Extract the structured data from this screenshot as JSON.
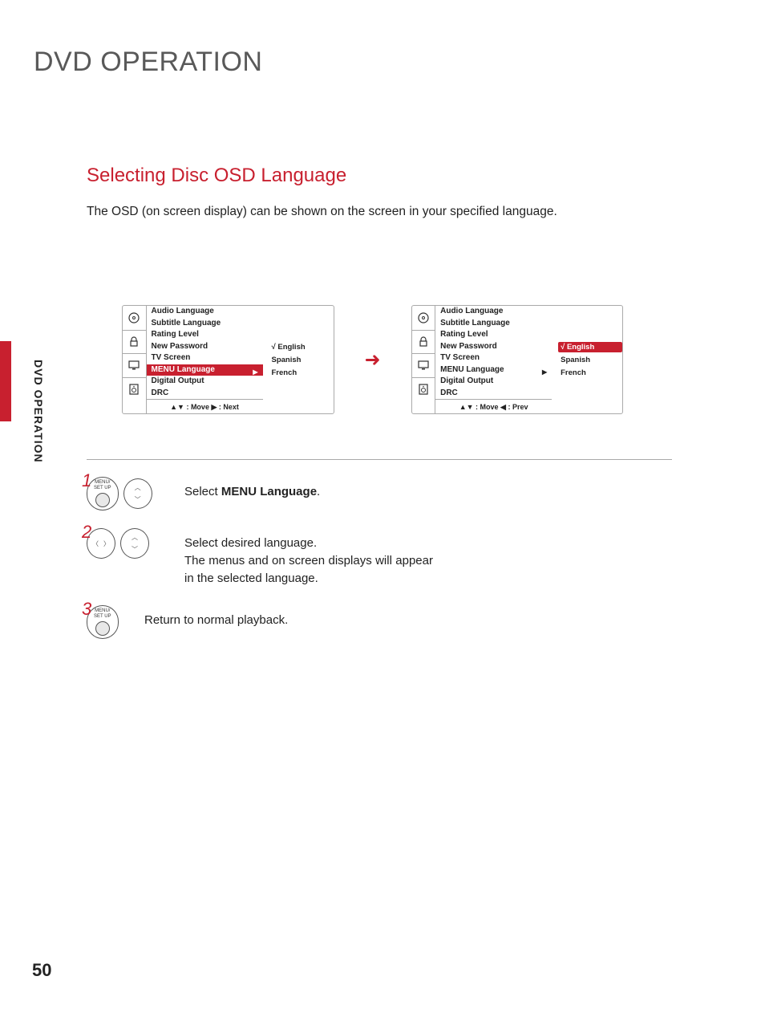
{
  "page_title": "DVD OPERATION",
  "section_title": "Selecting Disc OSD Language",
  "intro": "The OSD (on screen display) can be shown on the screen in your specified language.",
  "side_label": "DVD OPERATION",
  "page_number": "50",
  "osd_menu": {
    "items": [
      "Audio Language",
      "Subtitle Language",
      "Rating Level",
      "New Password",
      "TV Screen",
      "MENU Language",
      "Digital Output",
      "DRC"
    ],
    "nav_left": "▲▼ : Move    ▶ : Next",
    "nav_right": "▲▼ : Move    ◀ : Prev",
    "options": [
      "√ English",
      "Spanish",
      "French"
    ]
  },
  "steps": {
    "s1": {
      "num": "1",
      "btn_label": "MENU/\nSET UP",
      "text_pre": "Select ",
      "text_bold": "MENU Language",
      "text_post": "."
    },
    "s2": {
      "num": "2",
      "line1": "Select desired language.",
      "line2": "The menus and on screen displays will appear in the selected language."
    },
    "s3": {
      "num": "3",
      "btn_label": "MENU/\nSET UP",
      "text": "Return to normal playback."
    }
  }
}
